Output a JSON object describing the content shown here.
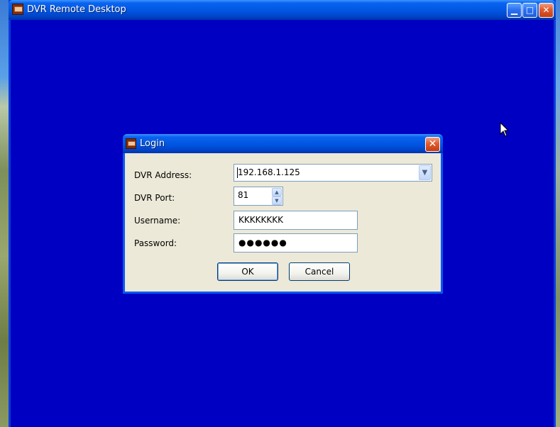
{
  "main_window": {
    "title": "DVR Remote Desktop",
    "minimize_glyph": "▁",
    "maximize_glyph": "□",
    "close_glyph": "✕"
  },
  "login_dialog": {
    "title": "Login",
    "close_glyph": "✕",
    "fields": {
      "address_label": "DVR Address:",
      "address_value": "192.168.1.125",
      "port_label": "DVR Port:",
      "port_value": "81",
      "username_label": "Username:",
      "username_value": "KKKKKKKK",
      "password_label": "Password:",
      "password_value": "●●●●●●"
    },
    "buttons": {
      "ok_label": "OK",
      "cancel_label": "Cancel"
    }
  },
  "icons": {
    "app_icon": "dvr-app-icon",
    "dropdown": "chevron-down-icon",
    "spin_up": "arrow-up-icon",
    "spin_down": "arrow-down-icon",
    "cursor": "mouse-pointer-icon"
  },
  "colors": {
    "client_background": "#0000c2",
    "titlebar_blue": "#0155e0",
    "dialog_face": "#ece9d8"
  }
}
